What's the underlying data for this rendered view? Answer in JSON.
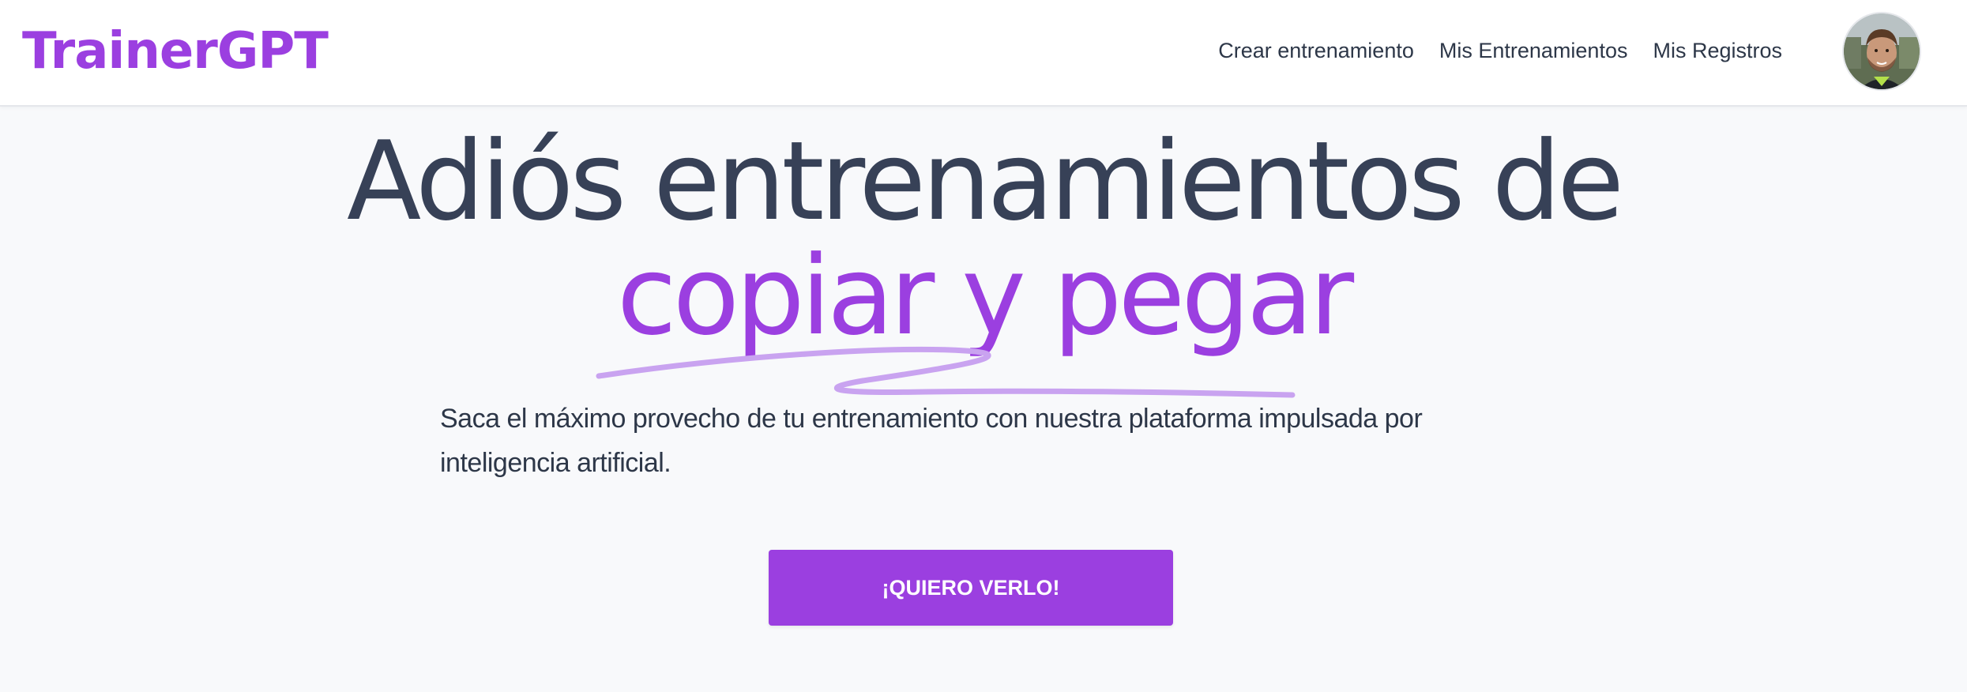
{
  "brand": {
    "name": "TrainerGPT",
    "accent_color": "#9b3fe0"
  },
  "nav": {
    "links": [
      {
        "label": "Crear entrenamiento"
      },
      {
        "label": "Mis Entrenamientos"
      },
      {
        "label": "Mis Registros"
      }
    ],
    "avatar_icon": "user-avatar-photo"
  },
  "hero": {
    "title_line1": "Adiós entrenamientos de",
    "title_line2": "copiar y pegar",
    "subtitle": "Saca el máximo provecho de tu entrenamiento con nuestra plataforma impulsada por inteligencia artificial.",
    "cta_label": "¡QUIERO VERLO!",
    "scribble_color": "#c9a3f0",
    "text_color": "#374157"
  }
}
